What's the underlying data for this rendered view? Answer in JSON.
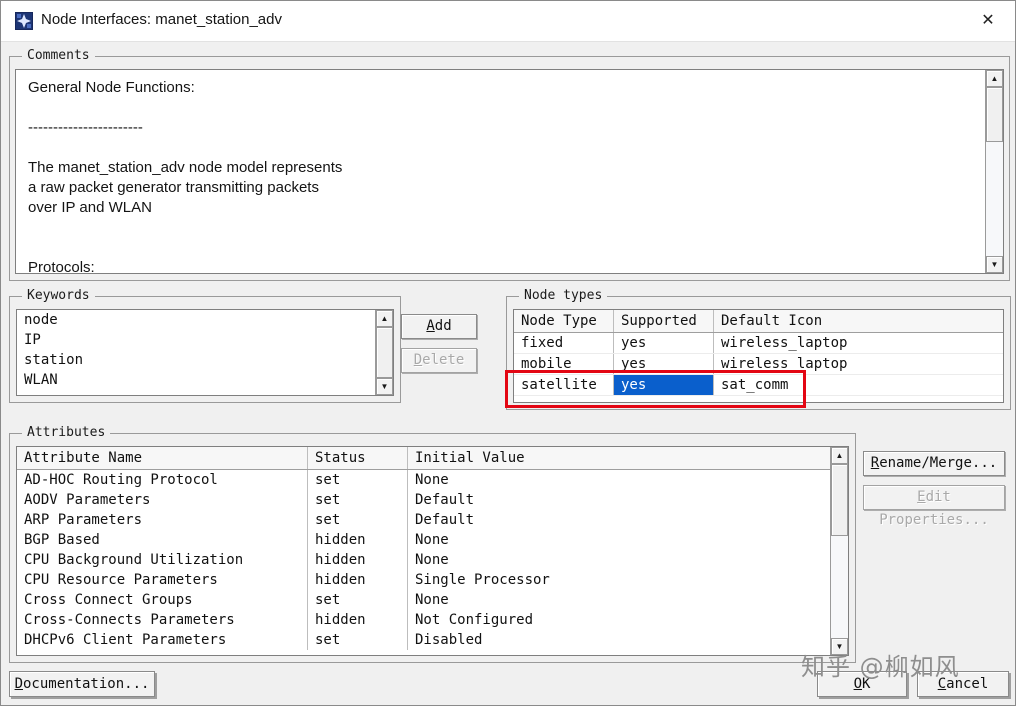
{
  "window": {
    "title": "Node Interfaces: manet_station_adv"
  },
  "icons": {
    "close": "✕",
    "scroll_up": "▲",
    "scroll_down": "▼"
  },
  "comments": {
    "label": "Comments",
    "text": "General Node Functions:\n\n-----------------------\n\nThe manet_station_adv node model represents\na raw packet generator transmitting packets\nover IP and WLAN\n\n\nProtocols:"
  },
  "keywords": {
    "label": "Keywords",
    "items": [
      "node",
      "IP",
      "station",
      "WLAN"
    ],
    "add_label": "Add",
    "delete_label": "Delete"
  },
  "node_types": {
    "label": "Node types",
    "headers": [
      "Node Type",
      "Supported",
      "Default Icon"
    ],
    "rows": [
      [
        "fixed",
        "yes",
        "wireless_laptop"
      ],
      [
        "mobile",
        "yes",
        "wireless_laptop"
      ],
      [
        "satellite",
        "yes",
        "sat_comm"
      ]
    ],
    "selection_color": "#0a5fcc",
    "annotation_color": "#e30613"
  },
  "attributes": {
    "label": "Attributes",
    "headers": [
      "Attribute Name",
      "Status",
      "Initial Value"
    ],
    "rows": [
      [
        "AD-HOC Routing Protocol",
        "set",
        "None"
      ],
      [
        "AODV Parameters",
        "set",
        "Default"
      ],
      [
        "ARP Parameters",
        "set",
        "Default"
      ],
      [
        "BGP Based",
        "hidden",
        "None"
      ],
      [
        "CPU Background Utilization",
        "hidden",
        "None"
      ],
      [
        "CPU Resource Parameters",
        "hidden",
        "Single Processor"
      ],
      [
        "Cross Connect Groups",
        "set",
        "None"
      ],
      [
        "Cross-Connects Parameters",
        "hidden",
        "Not Configured"
      ],
      [
        "DHCPv6 Client Parameters",
        "set",
        "Disabled"
      ]
    ],
    "rename_merge_label": "Rename/Merge...",
    "edit_properties_label": "Edit Properties..."
  },
  "buttons": {
    "documentation": "Documentation...",
    "ok": "OK",
    "cancel": "Cancel"
  },
  "watermark": "知乎 @柳如风"
}
